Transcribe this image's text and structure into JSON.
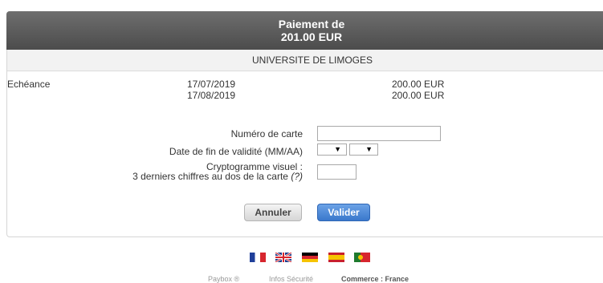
{
  "header": {
    "title_line1": "Paiement de",
    "title_line2": "201.00 EUR"
  },
  "merchant": "UNIVERSITE DE LIMOGES",
  "schedule": {
    "label": "Echéance",
    "rows": [
      {
        "date": "17/07/2019",
        "amount": "200.00 EUR"
      },
      {
        "date": "17/08/2019",
        "amount": "200.00 EUR"
      }
    ]
  },
  "form": {
    "card_number_label": "Numéro de carte",
    "card_number_value": "",
    "expiry_label": "Date de fin de validité (MM/AA)",
    "expiry_month": "",
    "expiry_year": "",
    "cvv_label_line1": "Cryptogramme visuel :",
    "cvv_label_line2": "3 derniers chiffres au dos de la carte",
    "cvv_help": "(?)",
    "cvv_value": ""
  },
  "buttons": {
    "cancel": "Annuler",
    "validate": "Valider"
  },
  "colors": {
    "header_bg": "#4c4c4c",
    "validate_bg": "#3a78cc",
    "merchant_bg": "#f2f2f2"
  },
  "languages": [
    {
      "icon": "flag-france-icon"
    },
    {
      "icon": "flag-uk-icon"
    },
    {
      "icon": "flag-germany-icon"
    },
    {
      "icon": "flag-spain-icon"
    },
    {
      "icon": "flag-portugal-icon"
    }
  ],
  "footer": {
    "paybox": "Paybox ®",
    "security": "Infos Sécurité",
    "commerce": "Commerce : France"
  }
}
